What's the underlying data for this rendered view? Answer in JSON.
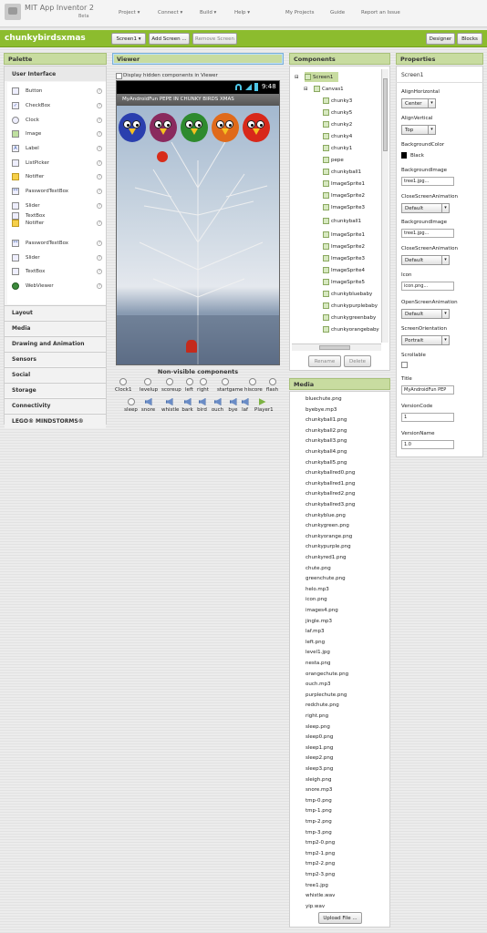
{
  "app": {
    "title": "MIT App Inventor 2",
    "subtitle": "Beta"
  },
  "nav": {
    "project": "Project ▾",
    "connect": "Connect ▾",
    "build": "Build ▾",
    "help": "Help ▾",
    "my_projects": "My Projects",
    "guide": "Guide",
    "report_issue": "Report an Issue"
  },
  "toolbar": {
    "project_name": "chunkybirdsxmas",
    "screen_select": "Screen1 ▾",
    "add_screen": "Add Screen ...",
    "remove_screen": "Remove Screen",
    "designer": "Designer",
    "blocks": "Blocks"
  },
  "palette": {
    "title": "Palette",
    "section": "User Interface",
    "items": [
      {
        "label": "Button",
        "icon": "button-icon"
      },
      {
        "label": "CheckBox",
        "icon": "checkbox-icon"
      },
      {
        "label": "Clock",
        "icon": "clock-icon"
      },
      {
        "label": "Image",
        "icon": "image-icon"
      },
      {
        "label": "Label",
        "icon": "label-icon"
      },
      {
        "label": "ListPicker",
        "icon": "listpicker-icon"
      },
      {
        "label": "Notifier",
        "icon": "notifier-icon"
      },
      {
        "label": "PasswordTextBox",
        "icon": "password-icon"
      },
      {
        "label": "Slider",
        "icon": "slider-icon"
      },
      {
        "label": "TextBox",
        "icon": "textbox-icon"
      },
      {
        "label": "Notifier",
        "icon": "notifier-icon"
      },
      {
        "label": "PasswordTextBox",
        "icon": "password-icon"
      },
      {
        "label": "Slider",
        "icon": "slider-icon"
      },
      {
        "label": "TextBox",
        "icon": "textbox-icon"
      },
      {
        "label": "WebViewer",
        "icon": "webviewer-icon"
      }
    ],
    "categories": [
      "Layout",
      "Media",
      "Drawing and Animation",
      "Sensors",
      "Social",
      "Storage",
      "Connectivity",
      "LEGO® MINDSTORMS®"
    ]
  },
  "viewer": {
    "title": "Viewer",
    "hidden_checkbox_label": "Display hidden components in Viewer",
    "phone_time": "9:48",
    "app_title": "MyAndroidFun PEPE IN CHUNKY BIRDS XMAS",
    "nonvisible_title": "Non-visible components",
    "nonvisible_row1": [
      "Clock1",
      "levelup",
      "scoreup",
      "left",
      "right",
      "startgame",
      "hiscore",
      "flash"
    ],
    "nonvisible_row2": [
      "sleep",
      "snore",
      "whistle",
      "bark",
      "bird",
      "ouch",
      "bye",
      "laf",
      "Player1"
    ]
  },
  "components": {
    "title": "Components",
    "tree": [
      "Screen1",
      "Canvas1",
      "chunky3",
      "chunky5",
      "chunky2",
      "chunky4",
      "chunky1",
      "pepe",
      "chunkyball1",
      "ImageSprite1",
      "ImageSprite2",
      "ImageSprite3",
      "chunkyball1",
      "ImageSprite1",
      "ImageSprite2",
      "ImageSprite3",
      "ImageSprite4",
      "ImageSprite5",
      "chunkybluebaby",
      "chunkypurplebaby",
      "chunkygreenbaby",
      "chunkyorangebaby"
    ],
    "rename": "Rename",
    "delete": "Delete"
  },
  "media": {
    "title": "Media",
    "files": [
      "bluechute.png",
      "byebye.mp3",
      "chunkyball1.png",
      "chunkyball2.png",
      "chunkyball3.png",
      "chunkyball4.png",
      "chunkyball5.png",
      "chunkyballred0.png",
      "chunkyballred1.png",
      "chunkyballred2.png",
      "chunkyballred3.png",
      "chunkyblue.png",
      "chunkygreen.png",
      "chunkyorange.png",
      "chunkypurple.png",
      "chunkyred1.png",
      "chute.png",
      "greenchute.png",
      "helo.mp3",
      "icon.png",
      "images4.png",
      "jingle.mp3",
      "laf.mp3",
      "left.png",
      "level1.jpg",
      "nesta.png",
      "orangechute.png",
      "ouch.mp3",
      "purplechute.png",
      "redchute.png",
      "right.png",
      "sleep.png",
      "sleep0.png",
      "sleep1.png",
      "sleep2.png",
      "sleep3.png",
      "sleigh.png",
      "snore.mp3",
      "tmp-0.png",
      "tmp-1.png",
      "tmp-2.png",
      "tmp-3.png",
      "tmp2-0.png",
      "tmp2-1.png",
      "tmp2-2.png",
      "tmp2-3.png",
      "tree1.jpg",
      "whistle.wav",
      "yip.wav"
    ],
    "upload": "Upload File ..."
  },
  "properties": {
    "title": "Properties",
    "component": "Screen1",
    "align_h_label": "AlignHorizontal",
    "align_h_value": "Center",
    "align_v_label": "AlignVertical",
    "align_v_value": "Top",
    "bgcolor_label": "BackgroundColor",
    "bgcolor_value": "Black",
    "bgimage_label": "BackgroundImage",
    "bgimage_value": "tree1.jpg...",
    "close_anim_label": "CloseScreenAnimation",
    "close_anim_value": "Default",
    "bgimage2_label": "BackgroundImage",
    "bgimage2_value": "tree1.jpg...",
    "close_anim2_label": "CloseScreenAnimation",
    "close_anim2_value": "Default",
    "icon_label": "Icon",
    "icon_value": "icon.png...",
    "open_anim_label": "OpenScreenAnimation",
    "open_anim_value": "Default",
    "orientation_label": "ScreenOrientation",
    "orientation_value": "Portrait",
    "scrollable_label": "Scrollable",
    "title_label": "Title",
    "title_value": "MyAndroidFun  PEP",
    "vcode_label": "VersionCode",
    "vcode_value": "1",
    "vname_label": "VersionName",
    "vname_value": "1.0"
  },
  "colors": {
    "green_bar": "#8cbc2e",
    "panel_header": "#c8dca0",
    "bird_colors": [
      "#2a3fae",
      "#8a2a5e",
      "#2e8a2e",
      "#e06a1a",
      "#d8281a"
    ]
  }
}
